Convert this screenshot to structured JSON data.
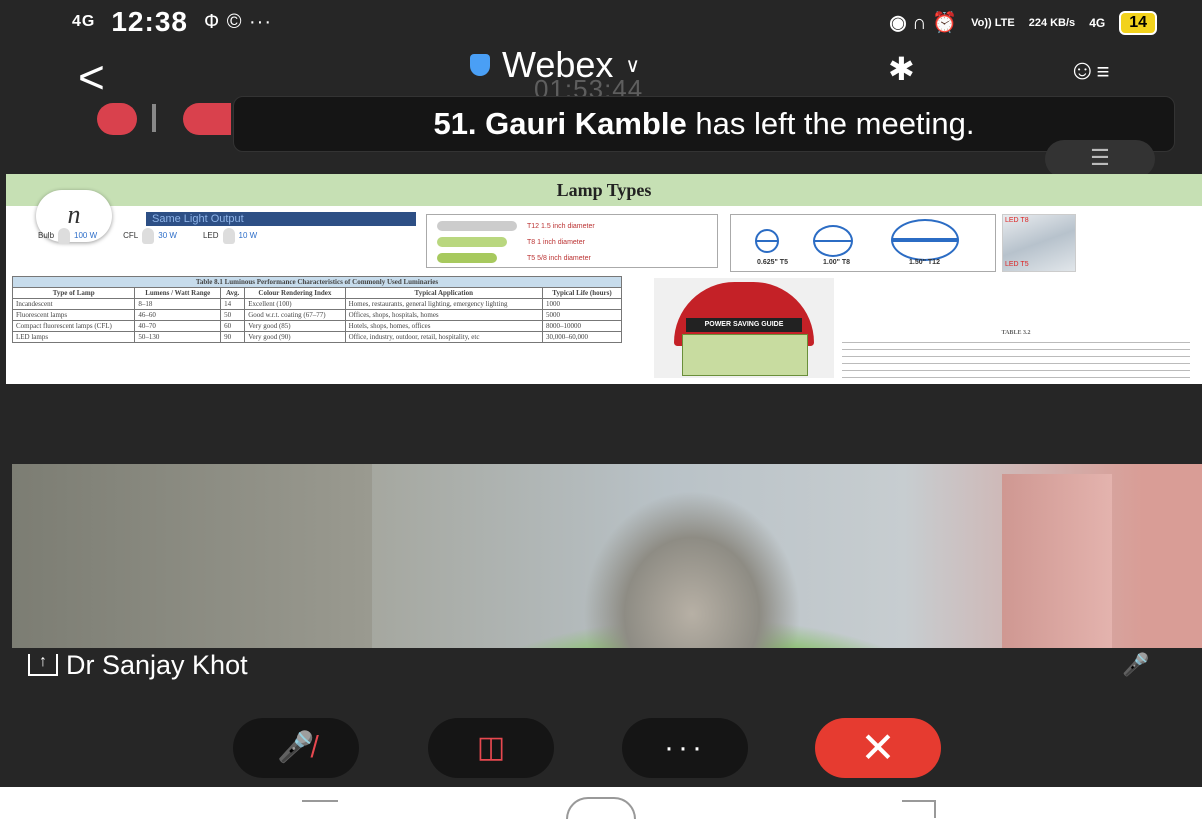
{
  "status_bar": {
    "network": "4G",
    "time": "12:38",
    "extra_icons": "Ф © ···",
    "right_icons": "◉ ∩ ⏰",
    "volte": "Vo)) LTE",
    "speed": "224 KB/s",
    "net2": "4G",
    "battery": "14"
  },
  "header": {
    "back_symbol": "<",
    "app_title": "Webex",
    "title_chevron": "∨",
    "timer": "01:53:44",
    "bluetooth_symbol": "✱",
    "participants_symbol": "≡"
  },
  "toast": {
    "name": "51. Gauri Kamble",
    "message": "has left the meeting."
  },
  "layout_button_symbol": "☰",
  "slide": {
    "title": "Lamp Types",
    "pen_glyph": "n",
    "same_output_label": "Same Light Output",
    "bulbs": [
      {
        "name": "Bulb",
        "watt": "100 W"
      },
      {
        "name": "CFL",
        "watt": "30 W"
      },
      {
        "name": "LED",
        "watt": "10 W"
      }
    ],
    "tubes": [
      {
        "label": "T12 1.5 inch diameter"
      },
      {
        "label": "T8 1 inch diameter"
      },
      {
        "label": "T5 5/8 inch diameter"
      }
    ],
    "diameters": [
      {
        "size": "0.625\"",
        "name": "T5"
      },
      {
        "size": "1.00\"",
        "name": "T8"
      },
      {
        "size": "1.50\"",
        "name": "T12"
      }
    ],
    "led_labels": [
      "LED T8",
      "LED T5"
    ],
    "table": {
      "caption": "Table 8.1 Luminous Performance Characteristics of Commonly Used Luminaries",
      "headers": [
        "Type of Lamp",
        "Lumens / Watt Range",
        "Avg.",
        "Colour Rendering Index",
        "Typical Application",
        "Typical Life (hours)"
      ],
      "rows": [
        [
          "Incandescent",
          "8–18",
          "14",
          "Excellent (100)",
          "Homes, restaurants, general lighting, emergency lighting",
          "1000"
        ],
        [
          "Fluorescent lamps",
          "46–60",
          "50",
          "Good w.r.t. coating (67–77)",
          "Offices, shops, hospitals, homes",
          "5000"
        ],
        [
          "Compact fluorescent lamps (CFL)",
          "40–70",
          "60",
          "Very good (85)",
          "Hotels, shops, homes, offices",
          "8000–10000"
        ],
        [
          "LED lamps",
          "50–130",
          "90",
          "Very good (90)",
          "Office, industry, outdoor, retail, hospitality, etc",
          "30,000–60,000"
        ]
      ]
    },
    "guide_label": "POWER SAVING GUIDE",
    "table32_title": "TABLE 3.2"
  },
  "video": {
    "participant_name": "Dr Sanjay Khot"
  },
  "controls": {
    "more_label": "···",
    "end_symbol": "✕"
  }
}
